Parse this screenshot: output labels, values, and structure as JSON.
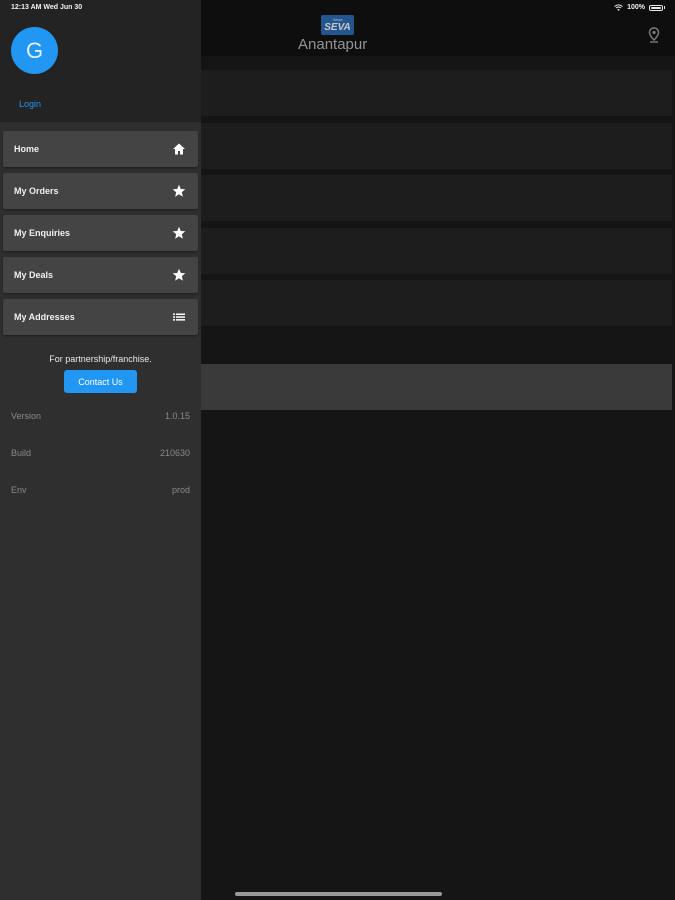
{
  "status_bar": {
    "time": "12:13 AM  Wed Jun 30",
    "battery": "100%",
    "wifi_icon": "wifi-icon",
    "battery_icon": "battery-icon"
  },
  "header": {
    "logo_top": "Sewa",
    "logo_main": "SEVA",
    "city": "Anantapur",
    "location_icon": "map-pin-icon"
  },
  "drawer": {
    "avatar_letter": "G",
    "login_label": "Login",
    "menu": [
      {
        "label": "Home",
        "icon": "home-icon"
      },
      {
        "label": "My Orders",
        "icon": "star-icon"
      },
      {
        "label": "My Enquiries",
        "icon": "star-icon"
      },
      {
        "label": "My Deals",
        "icon": "star-icon"
      },
      {
        "label": "My Addresses",
        "icon": "list-icon"
      }
    ],
    "partnership_text": "For partnership/franchise.",
    "contact_label": "Contact Us",
    "info": [
      {
        "label": "Version",
        "value": "1.0.15"
      },
      {
        "label": "Build",
        "value": "210630"
      },
      {
        "label": "Env",
        "value": "prod"
      }
    ]
  },
  "colors": {
    "accent": "#2196f3",
    "drawer_bg": "#2f2f2f",
    "menu_item_bg": "#444444",
    "app_bg": "#1b1b1b"
  }
}
